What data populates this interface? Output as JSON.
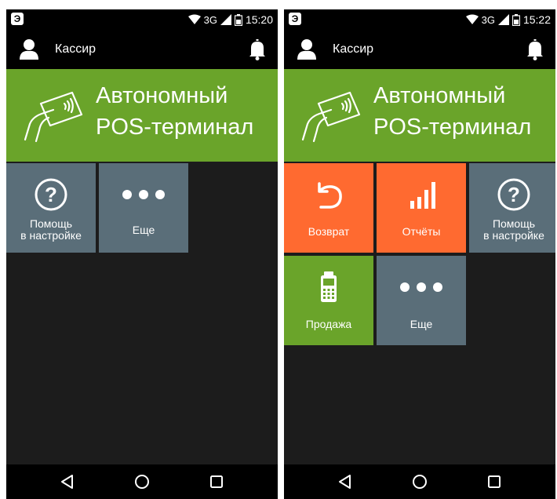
{
  "left": {
    "status": {
      "network": "3G",
      "time": "15:20"
    },
    "header": {
      "username": "Кассир"
    },
    "banner": {
      "line1": "Автономный",
      "line2": "POS-терминал"
    },
    "tiles": [
      {
        "line1": "Помощь",
        "line2": "в настройке",
        "icon": "help-icon",
        "color": "#5a6e79"
      },
      {
        "line1": "Еще",
        "line2": "",
        "icon": "more-dots-icon",
        "color": "#5a6e79"
      }
    ]
  },
  "right": {
    "status": {
      "network": "3G",
      "time": "15:22"
    },
    "header": {
      "username": "Кассир"
    },
    "banner": {
      "line1": "Автономный",
      "line2": "POS-терминал"
    },
    "tiles": [
      {
        "line1": "Возврат",
        "line2": "",
        "icon": "return-arrow-icon",
        "color": "#ff6a30"
      },
      {
        "line1": "Отчёты",
        "line2": "",
        "icon": "bar-chart-icon",
        "color": "#ff6a30"
      },
      {
        "line1": "Помощь",
        "line2": "в настройке",
        "icon": "help-icon",
        "color": "#5a6e79"
      },
      {
        "line1": "Продажа",
        "line2": "",
        "icon": "pos-terminal-icon",
        "color": "#6aa42a"
      },
      {
        "line1": "Еще",
        "line2": "",
        "icon": "more-dots-icon",
        "color": "#5a6e79"
      }
    ]
  },
  "colors": {
    "green": "#6aa42a",
    "orange": "#ff6a30",
    "slate": "#5a6e79",
    "background": "#1c1c1c"
  }
}
